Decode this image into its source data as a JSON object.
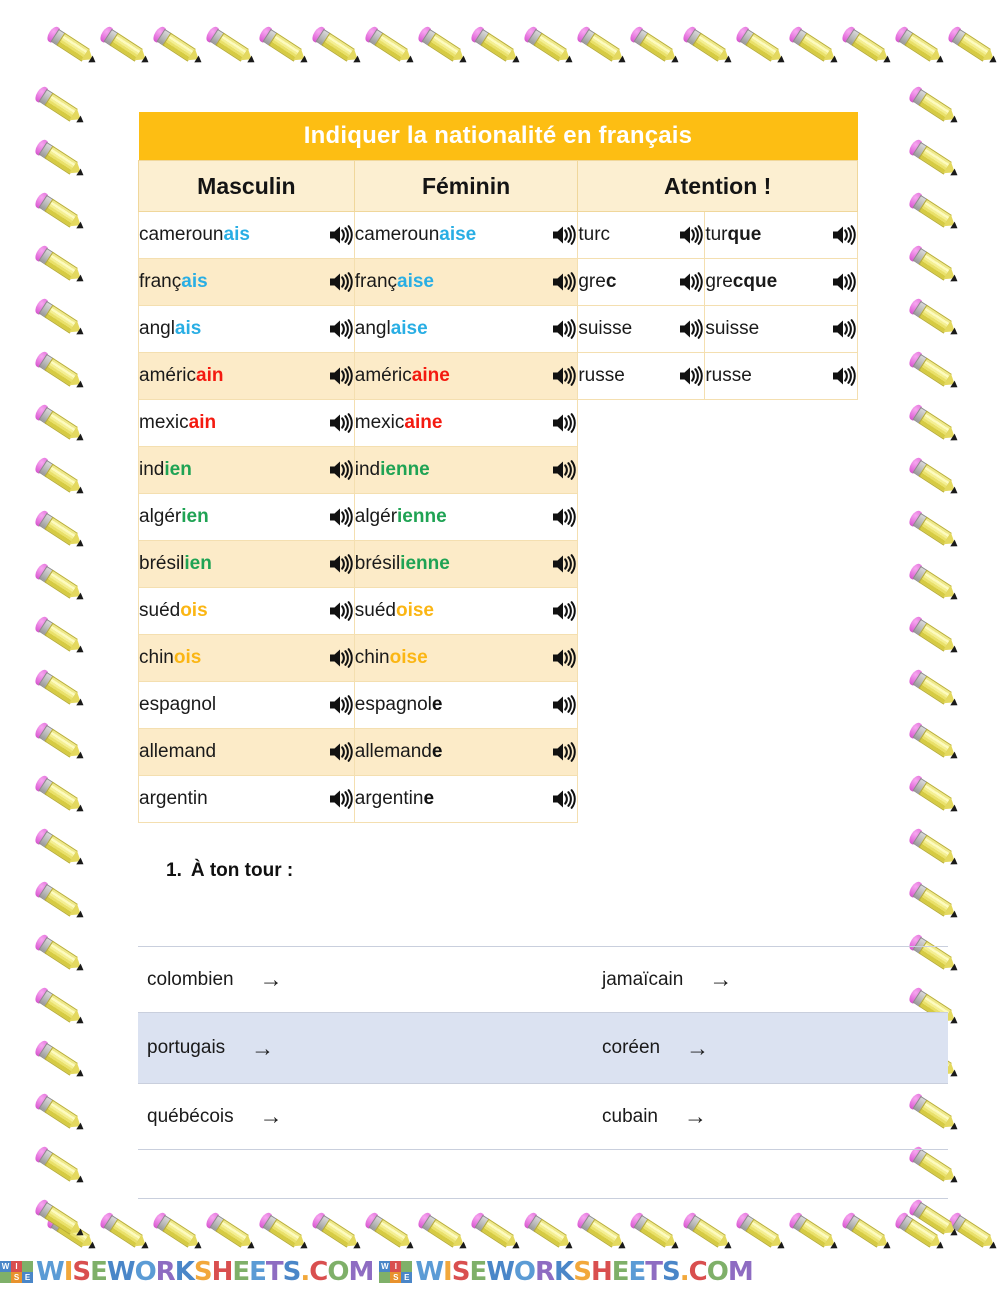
{
  "table": {
    "title": "Indiquer la nationalité en français",
    "headers": [
      "Masculin",
      "Féminin",
      "Atention !"
    ],
    "speaker_icon": "speaker-icon",
    "colors": {
      "title_bar": "#FDBE13",
      "header_row": "#FCEFD1",
      "row_alt": "#FCEBC8",
      "row_white": "#FFFFFF",
      "blue_suffix": "#29AEE4",
      "red_suffix": "#F41A10",
      "green_suffix": "#1FA354",
      "orange_suffix": "#FBB614",
      "black_suffix": "#111111",
      "exercise_highlight": "#DBE2F1"
    },
    "rows": [
      {
        "m_stem": "cameroun",
        "m_sfx": "ais",
        "f_stem": "cameroun",
        "f_sfx": "aise",
        "color": "blue"
      },
      {
        "m_stem": "franç",
        "m_sfx": "ais",
        "f_stem": "franç",
        "f_sfx": "aise",
        "color": "blue"
      },
      {
        "m_stem": "angl",
        "m_sfx": "ais",
        "f_stem": "angl",
        "f_sfx": "aise",
        "color": "blue"
      },
      {
        "m_stem": "améric",
        "m_sfx": "ain",
        "f_stem": "améric",
        "f_sfx": "aine",
        "color": "red"
      },
      {
        "m_stem": "mexic",
        "m_sfx": "ain",
        "f_stem": "mexic",
        "f_sfx": "aine",
        "color": "red"
      },
      {
        "m_stem": "ind",
        "m_sfx": "ien",
        "f_stem": "ind",
        "f_sfx": "ienne",
        "color": "green"
      },
      {
        "m_stem": "algér",
        "m_sfx": "ien",
        "f_stem": "algér",
        "f_sfx": "ienne",
        "color": "green"
      },
      {
        "m_stem": "brésil",
        "m_sfx": "ien",
        "f_stem": "brésil",
        "f_sfx": "ienne",
        "color": "green"
      },
      {
        "m_stem": "suéd",
        "m_sfx": "ois",
        "f_stem": "suéd",
        "f_sfx": "oise",
        "color": "orange"
      },
      {
        "m_stem": "chin",
        "m_sfx": "ois",
        "f_stem": "chin",
        "f_sfx": "oise",
        "color": "orange"
      },
      {
        "m_stem": "espagnol",
        "m_sfx": "",
        "f_stem": "espagnol",
        "f_sfx": "e",
        "color": "black"
      },
      {
        "m_stem": "allemand",
        "m_sfx": "",
        "f_stem": "allemand",
        "f_sfx": "e",
        "color": "black"
      },
      {
        "m_stem": "argentin",
        "m_sfx": "",
        "f_stem": "argentin",
        "f_sfx": "e",
        "color": "black"
      }
    ],
    "attention_rows": [
      {
        "m_stem": "tur",
        "m_sfx": "c",
        "m_bold": false,
        "f_stem": "tur",
        "f_sfx": "que",
        "f_bold": true
      },
      {
        "m_stem": "gre",
        "m_sfx": "c",
        "m_bold": true,
        "f_stem": "gre",
        "f_sfx": "cque",
        "f_bold": true
      },
      {
        "m_stem": "suisse",
        "m_sfx": "",
        "m_bold": false,
        "f_stem": "suisse",
        "f_sfx": "",
        "f_bold": false
      },
      {
        "m_stem": "russe",
        "m_sfx": "",
        "m_bold": false,
        "f_stem": "russe",
        "f_sfx": "",
        "f_bold": false
      }
    ]
  },
  "exercise": {
    "number": "1.",
    "title": "À ton tour :",
    "arrow": "→",
    "rows": [
      {
        "left": "colombien",
        "right": "jamaïcain",
        "highlight": false
      },
      {
        "left": "portugais",
        "right": "coréen",
        "highlight": true
      },
      {
        "left": "québécois",
        "right": "cubain",
        "highlight": false
      }
    ]
  },
  "footer": {
    "watermark": "WISEWORKSHEETS.COM",
    "badge_letters": [
      "W",
      "I",
      "",
      "",
      "S",
      "E"
    ],
    "repeat": 2
  }
}
